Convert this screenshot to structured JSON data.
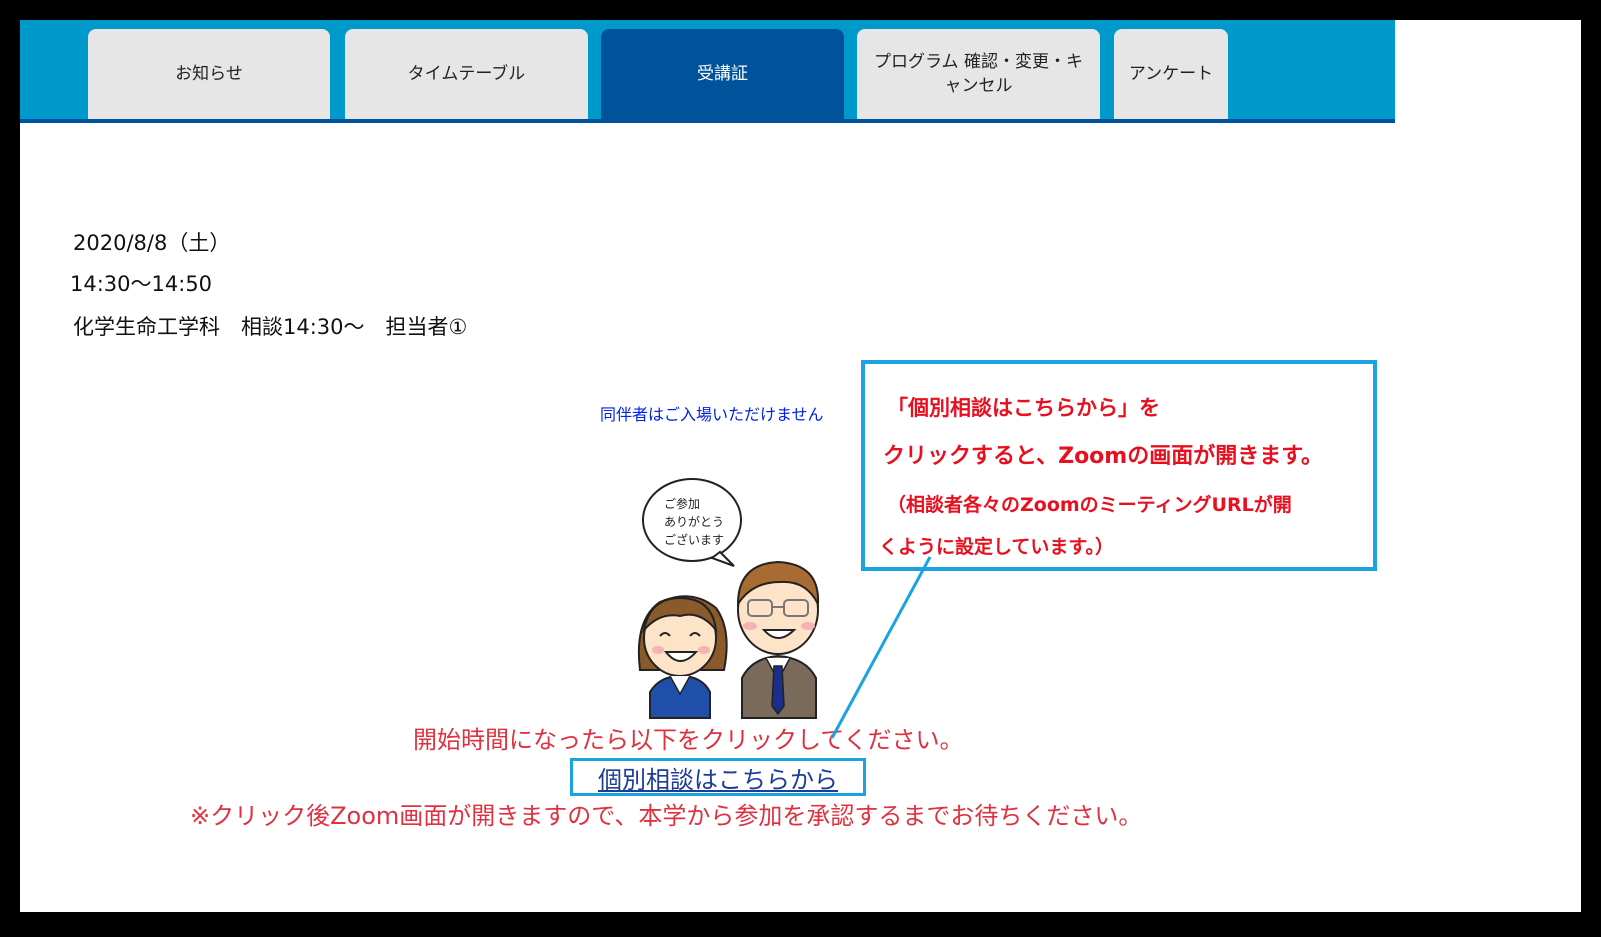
{
  "nav": {
    "tabs": [
      {
        "label": "お知らせ"
      },
      {
        "label": "タイムテーブル"
      },
      {
        "label": "受講証",
        "active": true
      },
      {
        "label": "プログラム 確認・変更・キャンセル"
      },
      {
        "label": "アンケート"
      }
    ]
  },
  "session": {
    "date": "2020/8/8（土）",
    "time": "14:30～14:50",
    "title": "化学生命工学科　相談14:30～　担当者①"
  },
  "companion_note": "同伴者はご入場いただけません",
  "illustration": {
    "speech_line1": "ご参加",
    "speech_line2": "ありがとう",
    "speech_line3": "ございます"
  },
  "start_message": "開始時間になったら以下をクリックしてください。",
  "consult_link": "個別相談はこちらから",
  "zoom_note": "※クリック後Zoom画面が開きますので、本学から参加を承認するまでお待ちください。",
  "callout": {
    "line1": "「個別相談はこちらから」を",
    "line2": "クリックすると、Zoomの画面が開きます。",
    "line3": "（相談者各々のZoomのミーティングURLが開",
    "line4": "くように設定しています。）"
  },
  "colors": {
    "nav_bar": "#0099cc",
    "nav_active": "#00529b",
    "callout_border": "#1aa3e0",
    "alert_red": "#e03140"
  }
}
